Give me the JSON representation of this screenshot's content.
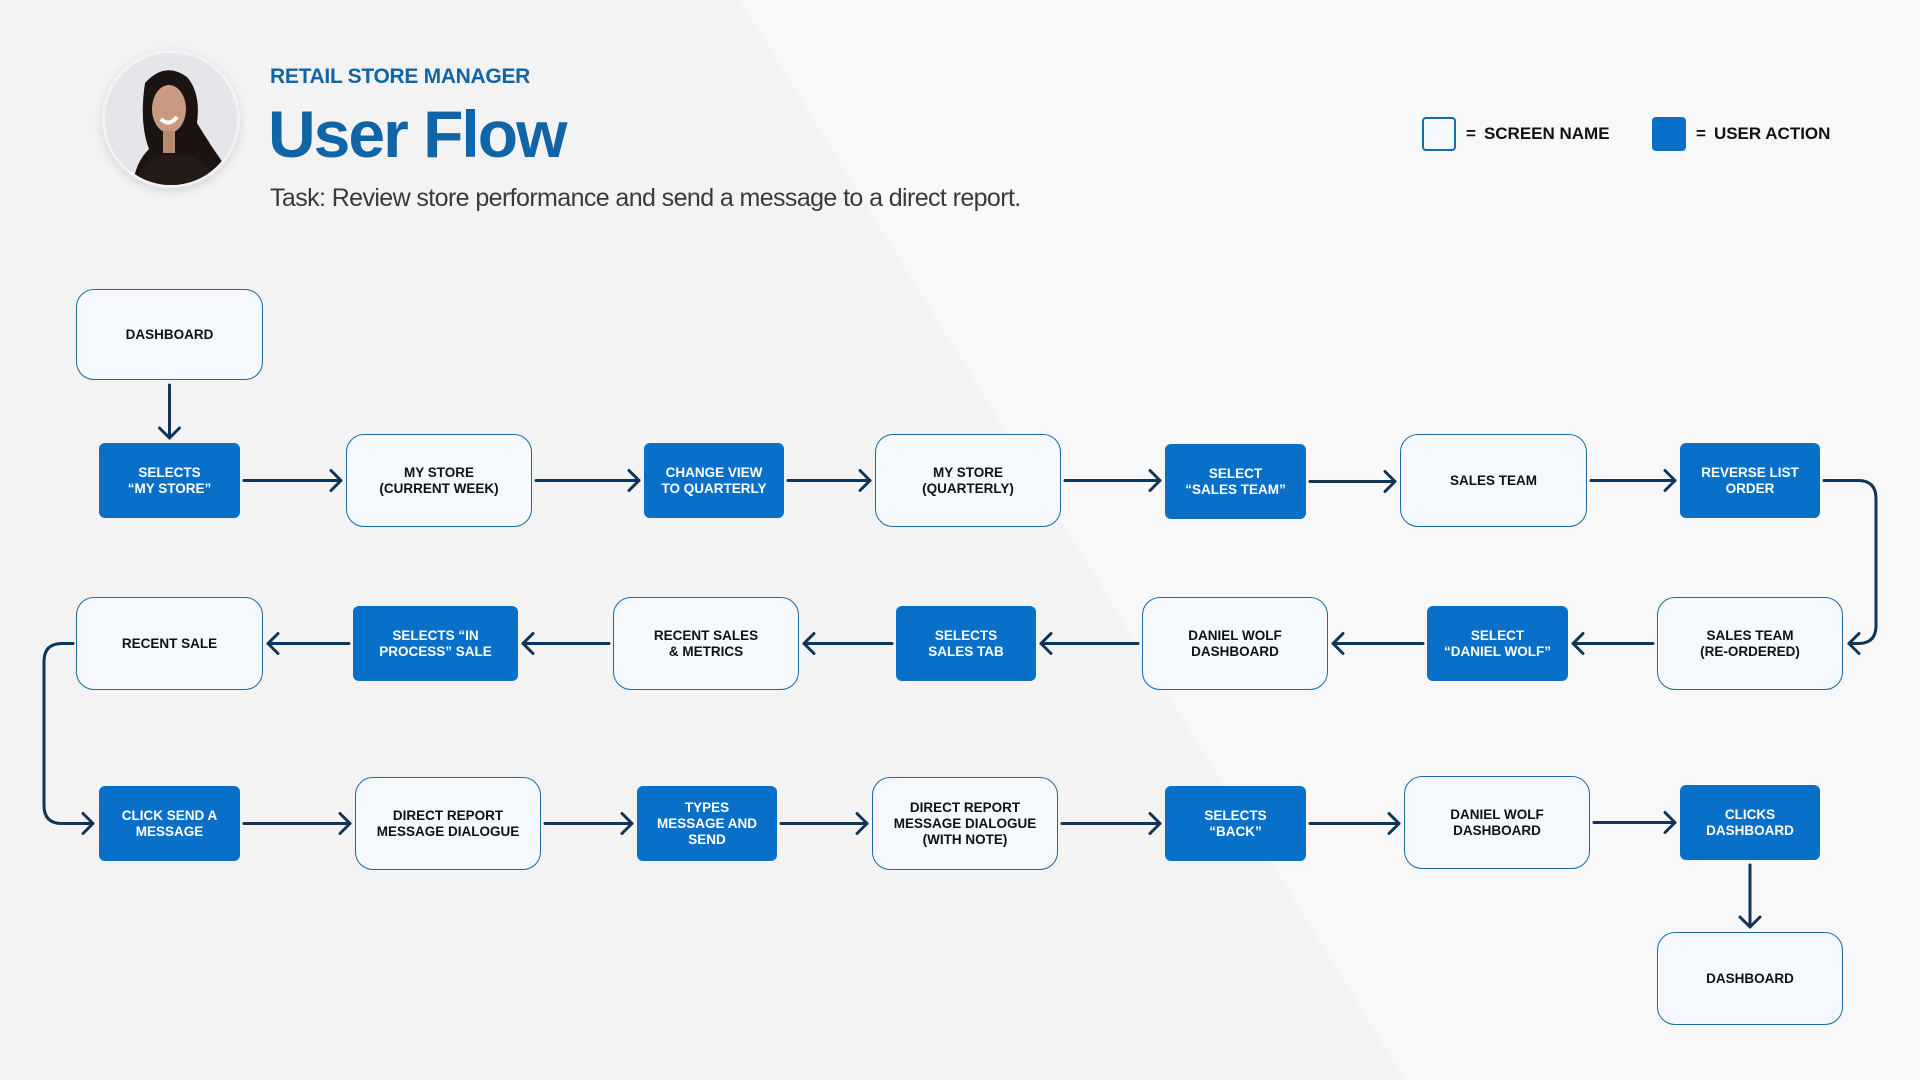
{
  "header": {
    "role": "RETAIL STORE MANAGER",
    "title": "User Flow",
    "task": "Task: Review store performance and send a message to a direct report."
  },
  "avatar": {
    "alt": "retail store manager persona photo"
  },
  "legend": {
    "screen_equals": "=",
    "screen_label": "SCREEN NAME",
    "action_equals": "=",
    "action_label": "USER ACTION"
  },
  "colors": {
    "title_blue": "#1065a6",
    "action_fill": "#0970c9",
    "screen_fill": "#f5f8fc",
    "screen_border": "#1a6aa3",
    "arrow": "#0f3558"
  },
  "nodes": [
    {
      "id": "n0",
      "type": "screen",
      "label": "DASHBOARD"
    },
    {
      "id": "n1",
      "type": "action",
      "label": "SELECTS\n“MY STORE”"
    },
    {
      "id": "n2",
      "type": "screen",
      "label": "MY STORE\n(CURRENT WEEK)"
    },
    {
      "id": "n3",
      "type": "action",
      "label": "CHANGE VIEW\nTO QUARTERLY"
    },
    {
      "id": "n4",
      "type": "screen",
      "label": "MY STORE\n(QUARTERLY)"
    },
    {
      "id": "n5",
      "type": "action",
      "label": "SELECT\n“SALES TEAM”"
    },
    {
      "id": "n6",
      "type": "screen",
      "label": "SALES TEAM"
    },
    {
      "id": "n7",
      "type": "action",
      "label": "REVERSE LIST\nORDER"
    },
    {
      "id": "n8",
      "type": "screen",
      "label": "SALES TEAM\n(RE-ORDERED)"
    },
    {
      "id": "n9",
      "type": "action",
      "label": "SELECT\n“DANIEL WOLF”"
    },
    {
      "id": "n10",
      "type": "screen",
      "label": "DANIEL WOLF\nDASHBOARD"
    },
    {
      "id": "n11",
      "type": "action",
      "label": "SELECTS\nSALES TAB"
    },
    {
      "id": "n12",
      "type": "screen",
      "label": "RECENT SALES\n& METRICS"
    },
    {
      "id": "n13",
      "type": "action",
      "label": "SELECTS “IN\nPROCESS” SALE"
    },
    {
      "id": "n14",
      "type": "screen",
      "label": "RECENT SALE"
    },
    {
      "id": "n15",
      "type": "action",
      "label": "CLICK SEND A\nMESSAGE"
    },
    {
      "id": "n16",
      "type": "screen",
      "label": "DIRECT REPORT\nMESSAGE DIALOGUE"
    },
    {
      "id": "n17",
      "type": "action",
      "label": "TYPES\nMESSAGE AND\nSEND"
    },
    {
      "id": "n18",
      "type": "screen",
      "label": "DIRECT REPORT\nMESSAGE DIALOGUE\n(WITH NOTE)"
    },
    {
      "id": "n19",
      "type": "action",
      "label": "SELECTS\n“BACK”"
    },
    {
      "id": "n20",
      "type": "screen",
      "label": "DANIEL WOLF\nDASHBOARD"
    },
    {
      "id": "n21",
      "type": "action",
      "label": "CLICKS\nDASHBOARD"
    },
    {
      "id": "n22",
      "type": "screen",
      "label": "DASHBOARD"
    }
  ],
  "edges": [
    [
      "n0",
      "n1"
    ],
    [
      "n1",
      "n2"
    ],
    [
      "n2",
      "n3"
    ],
    [
      "n3",
      "n4"
    ],
    [
      "n4",
      "n5"
    ],
    [
      "n5",
      "n6"
    ],
    [
      "n6",
      "n7"
    ],
    [
      "n7",
      "n8"
    ],
    [
      "n8",
      "n9"
    ],
    [
      "n9",
      "n10"
    ],
    [
      "n10",
      "n11"
    ],
    [
      "n11",
      "n12"
    ],
    [
      "n12",
      "n13"
    ],
    [
      "n13",
      "n14"
    ],
    [
      "n14",
      "n15"
    ],
    [
      "n15",
      "n16"
    ],
    [
      "n16",
      "n17"
    ],
    [
      "n17",
      "n18"
    ],
    [
      "n18",
      "n19"
    ],
    [
      "n19",
      "n20"
    ],
    [
      "n20",
      "n21"
    ],
    [
      "n21",
      "n22"
    ]
  ]
}
